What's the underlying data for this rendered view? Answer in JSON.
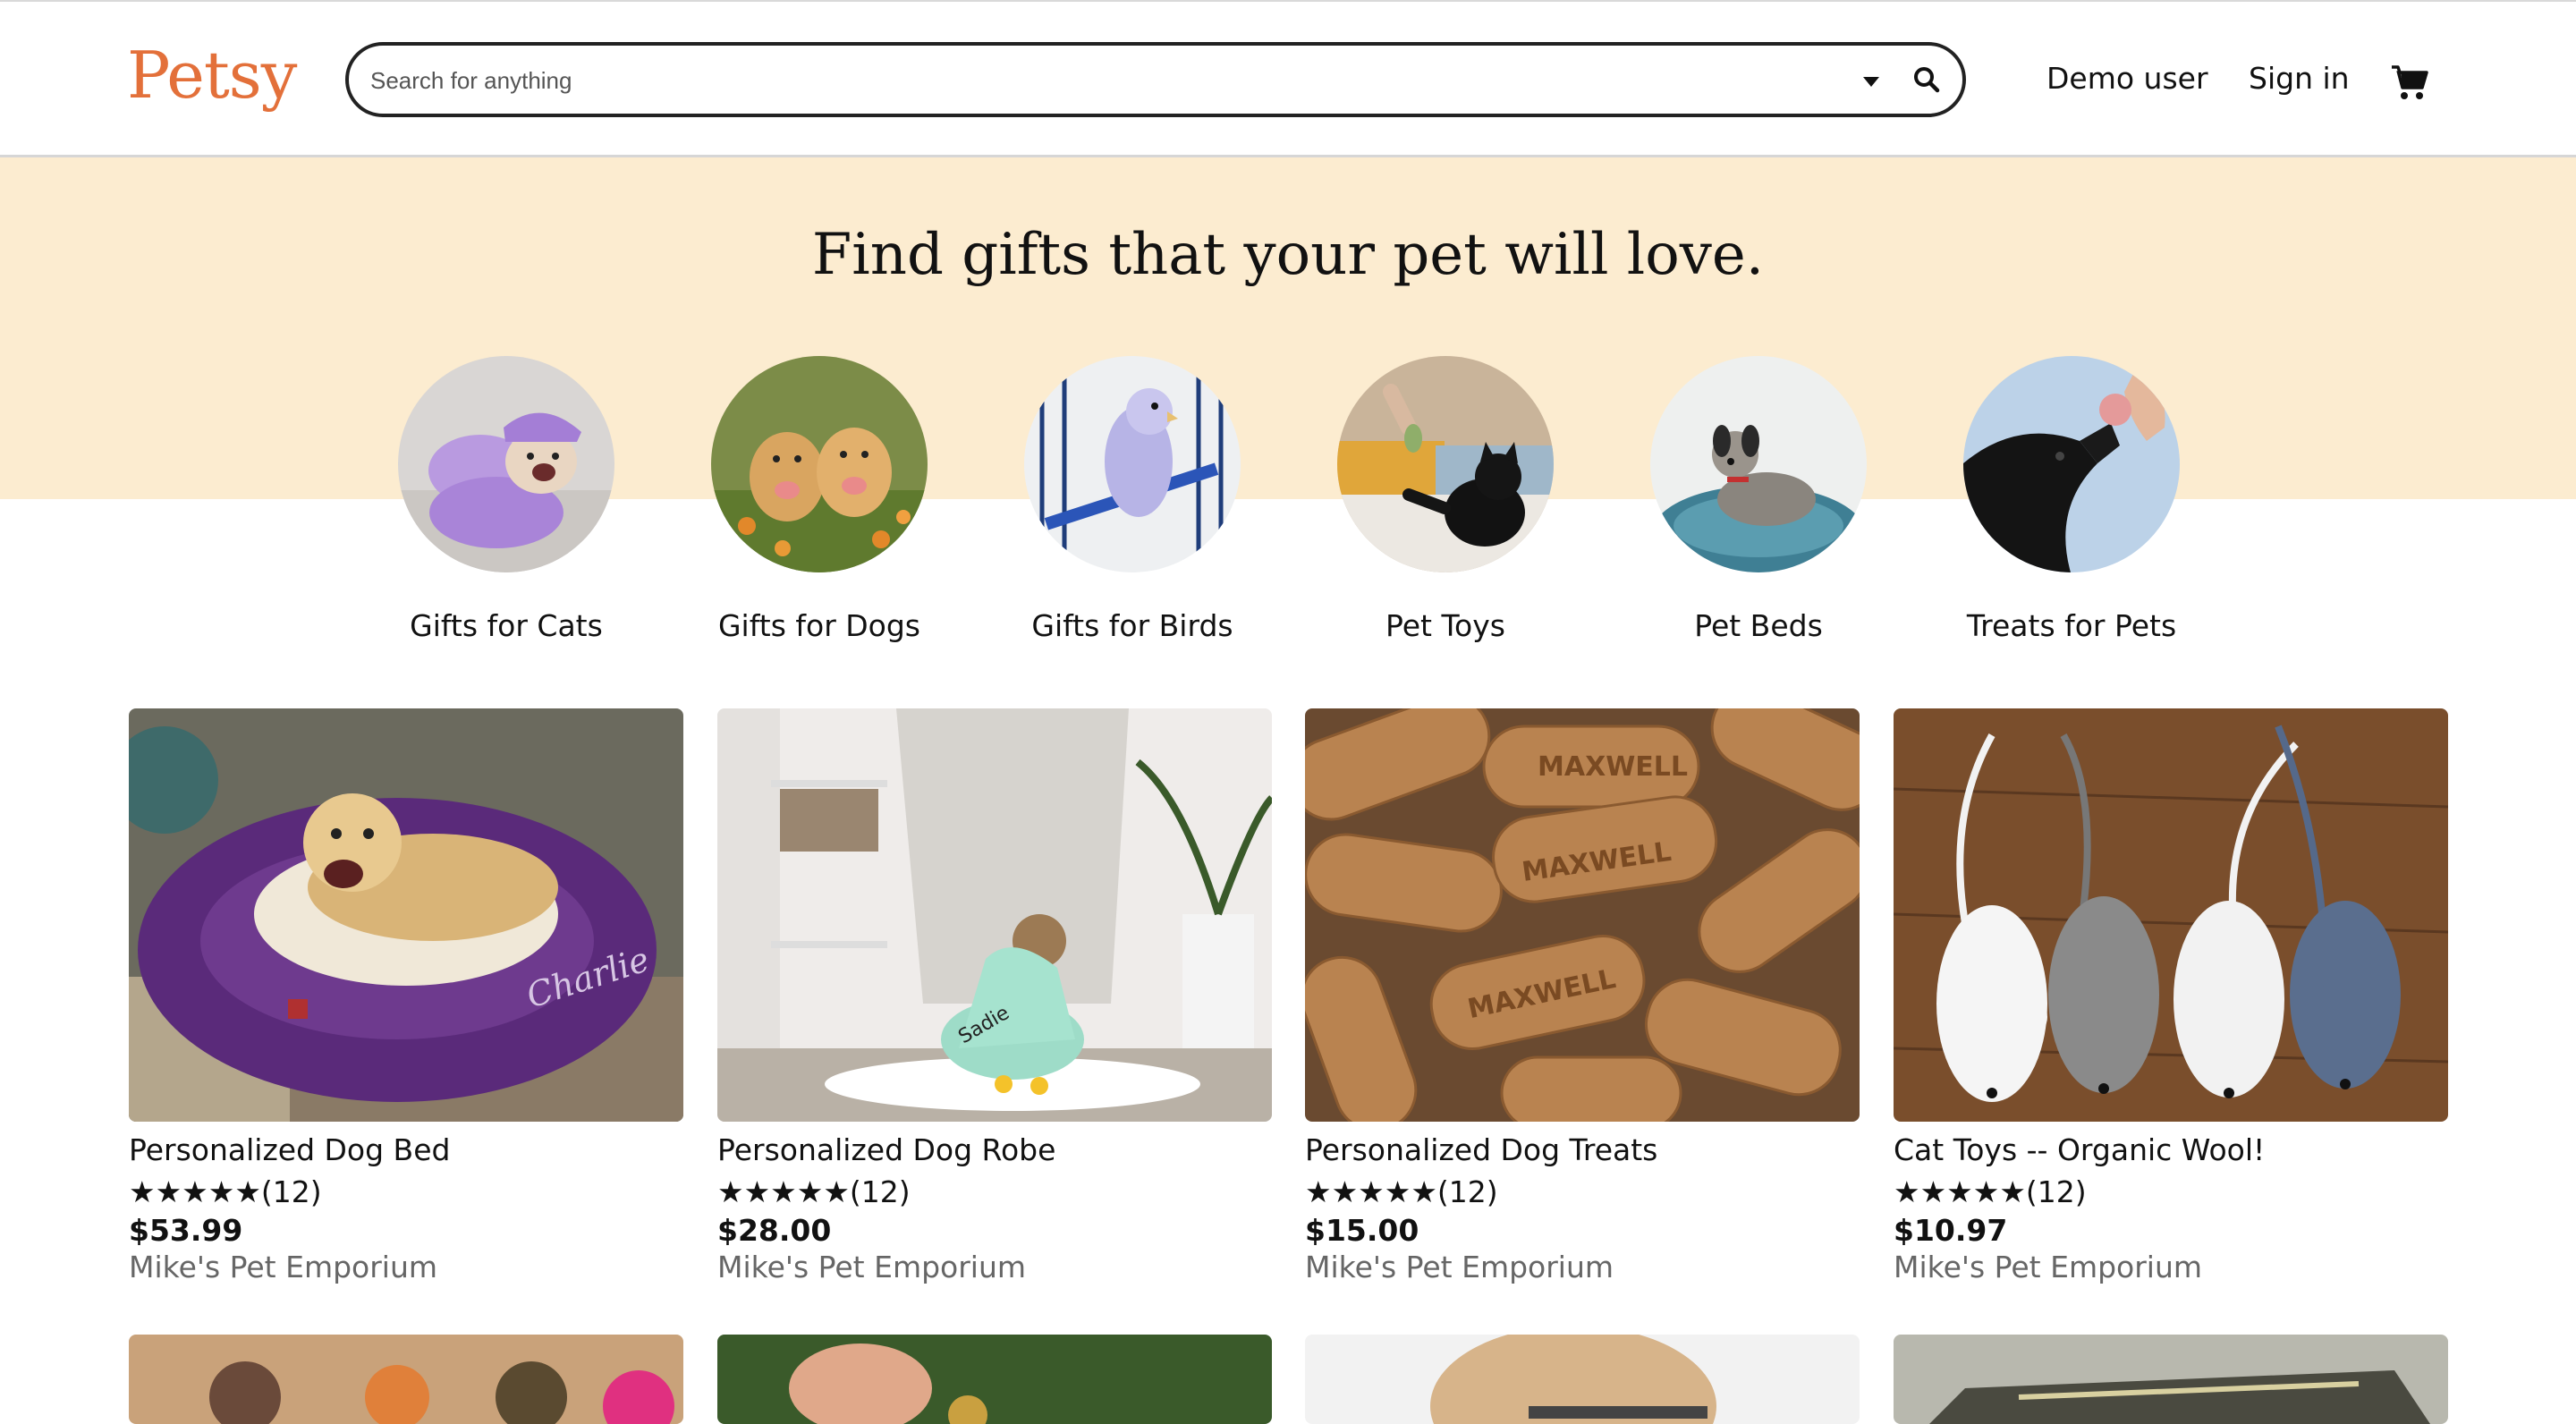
{
  "header": {
    "logo": "Petsy",
    "search_placeholder": "Search for anything",
    "user_label": "Demo user",
    "signin_label": "Sign in"
  },
  "hero": {
    "title": "Find gifts that your pet will love."
  },
  "categories": [
    {
      "label": "Gifts for Cats"
    },
    {
      "label": "Gifts for Dogs"
    },
    {
      "label": "Gifts for Birds"
    },
    {
      "label": "Pet Toys"
    },
    {
      "label": "Pet Beds"
    },
    {
      "label": "Treats for Pets"
    }
  ],
  "products": [
    {
      "title": "Personalized Dog Bed",
      "stars": "★★★★★",
      "reviews": "(12)",
      "price": "$53.99",
      "shop": "Mike's Pet Emporium"
    },
    {
      "title": "Personalized Dog Robe",
      "stars": "★★★★★",
      "reviews": "(12)",
      "price": "$28.00",
      "shop": "Mike's Pet Emporium"
    },
    {
      "title": "Personalized Dog Treats",
      "stars": "★★★★★",
      "reviews": "(12)",
      "price": "$15.00",
      "shop": "Mike's Pet Emporium"
    },
    {
      "title": "Cat Toys -- Organic Wool!",
      "stars": "★★★★★",
      "reviews": "(12)",
      "price": "$10.97",
      "shop": "Mike's Pet Emporium"
    }
  ],
  "image_text": {
    "bed_name": "Charlie",
    "robe_name": "Sadie",
    "treat_brand": "MAXWELL"
  },
  "colors": {
    "brand": "#e3703a",
    "hero_band": "#fcecd0",
    "shop_text": "#666666"
  }
}
